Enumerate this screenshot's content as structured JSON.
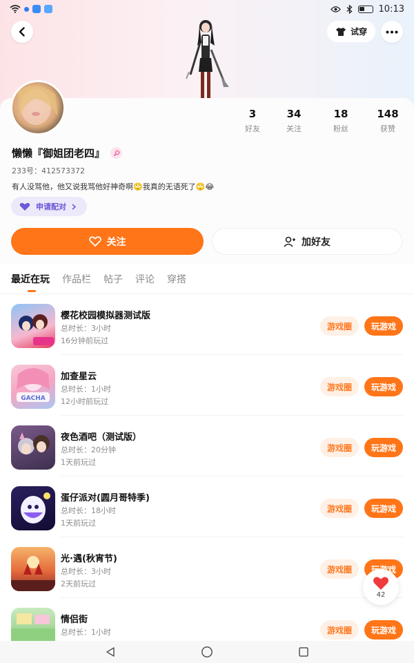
{
  "status_bar": {
    "time": "10:13"
  },
  "header": {
    "try_on_label": "试穿"
  },
  "profile": {
    "nickname": "懒懒『御姐团老四』",
    "uid": "233号：412573372",
    "bio": "有人没骂他，他又说我骂他好神奇啊🙄我真的无语死了🙄😂",
    "match_label": "申请配对",
    "stats": [
      {
        "value": "3",
        "label": "好友"
      },
      {
        "value": "34",
        "label": "关注"
      },
      {
        "value": "18",
        "label": "粉丝"
      },
      {
        "value": "148",
        "label": "获赞"
      }
    ],
    "follow_label": "关注",
    "add_friend_label": "加好友"
  },
  "tabs": [
    {
      "label": "最近在玩",
      "active": true
    },
    {
      "label": "作品栏",
      "active": false
    },
    {
      "label": "帖子",
      "active": false
    },
    {
      "label": "评论",
      "active": false
    },
    {
      "label": "穿搭",
      "active": false
    }
  ],
  "games": [
    {
      "title": "樱花校园模拟器测试版",
      "duration": "总时长：3小时",
      "last_played": "16分钟前玩过"
    },
    {
      "title": "加查星云",
      "duration": "总时长：1小时",
      "last_played": "12小时前玩过"
    },
    {
      "title": "夜色酒吧（测试版）",
      "duration": "总时长：20分钟",
      "last_played": "1天前玩过"
    },
    {
      "title": "蛋仔派对(圆月哥特季)",
      "duration": "总时长：18小时",
      "last_played": "1天前玩过"
    },
    {
      "title": "光·遇(秋宵节)",
      "duration": "总时长：3小时",
      "last_played": "2天前玩过"
    },
    {
      "title": "情侣街",
      "duration": "总时长：1小时",
      "last_played": ""
    }
  ],
  "game_buttons": {
    "circle_label": "游戏圈",
    "play_label": "玩游戏"
  },
  "like_fab": {
    "count": "42"
  },
  "colors": {
    "accent": "#ff7518",
    "match_purple": "#6a59d6"
  }
}
